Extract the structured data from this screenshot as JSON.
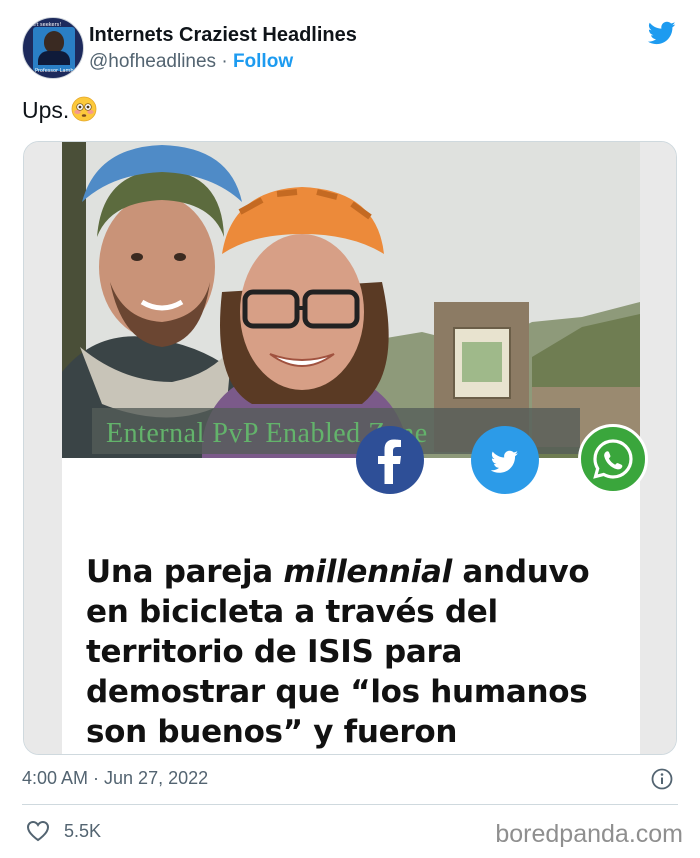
{
  "author": {
    "name": "Internets Craziest Headlines",
    "handle": "@hofheadlines",
    "separator": "·",
    "follow_label": "Follow",
    "avatar_text_top": "Art seekers!",
    "avatar_text_bottom": "Professor Lambert"
  },
  "tweet": {
    "text": "Ups.",
    "emoji": "flushed-face-emoji"
  },
  "media": {
    "banner_text": "Enternal PvP Enabled Zone",
    "share_icons": [
      "facebook-icon",
      "twitter-icon",
      "whatsapp-icon"
    ],
    "headline_part1": "Una pareja ",
    "headline_italic": "millennial",
    "headline_part2": " anduvo en bicicleta a través del territorio de ISIS para demostrar que “los humanos son buenos” y fueron asesinados"
  },
  "meta": {
    "timestamp": "4:00 AM · Jun 27, 2022",
    "likes": "5.5K"
  },
  "watermark": "boredpanda.com",
  "colors": {
    "twitter_blue": "#1d9bf0",
    "facebook_blue": "#2e4f97",
    "whatsapp_green": "#3aa63c",
    "banner_green": "#63b36b"
  }
}
